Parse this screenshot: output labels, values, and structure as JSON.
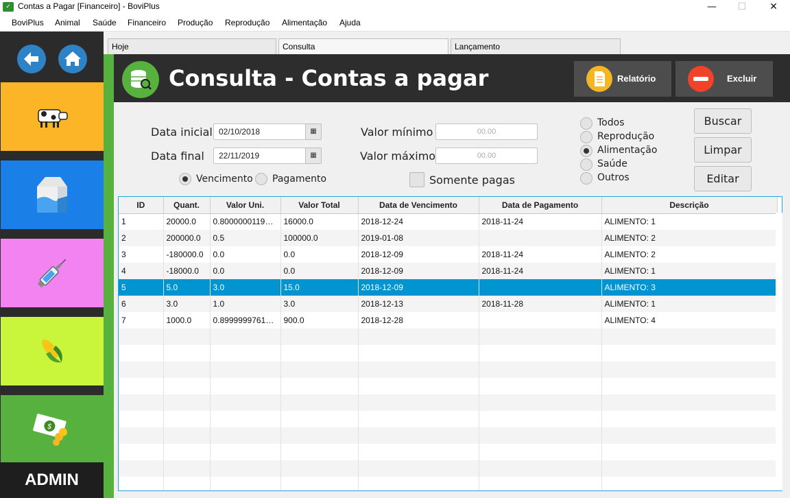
{
  "window": {
    "title": "Contas a Pagar [Financeiro] - BoviPlus",
    "minimize": "—",
    "maximize": "☐",
    "close": "✕"
  },
  "menu": [
    "BoviPlus",
    "Animal",
    "Saúde",
    "Financeiro",
    "Produção",
    "Reprodução",
    "Alimentação",
    "Ajuda"
  ],
  "sidebar": {
    "back_icon": "arrow-left-icon",
    "home_icon": "home-icon",
    "tiles": [
      {
        "name": "cow",
        "color": "#fbb526"
      },
      {
        "name": "milk",
        "color": "#1a80e8"
      },
      {
        "name": "syringe",
        "color": "#f283f0"
      },
      {
        "name": "corn",
        "color": "#c9f53a"
      },
      {
        "name": "money",
        "color": "#57b13e"
      }
    ],
    "admin_label": "ADMIN"
  },
  "tabs": [
    "Hoje",
    "Consulta",
    "Lançamento"
  ],
  "header": {
    "title": "Consulta - Contas a pagar",
    "report_button": "Relatório",
    "delete_button": "Excluir"
  },
  "filters": {
    "start_date_label": "Data inicial",
    "start_date": "02/10/2018",
    "end_date_label": "Data final",
    "end_date": "22/11/2019",
    "min_value_label": "Valor mínimo",
    "min_value_placeholder": "00.00",
    "max_value_label": "Valor máximo",
    "max_value_placeholder": "00.00",
    "date_type": [
      {
        "label": "Vencimento",
        "selected": true
      },
      {
        "label": "Pagamento",
        "selected": false
      }
    ],
    "only_paid_label": "Somente pagas",
    "only_paid_checked": false,
    "categories": [
      {
        "label": "Todos",
        "selected": false
      },
      {
        "label": "Reprodução",
        "selected": false
      },
      {
        "label": "Alimentação",
        "selected": true
      },
      {
        "label": "Saúde",
        "selected": false
      },
      {
        "label": "Outros",
        "selected": false
      }
    ]
  },
  "actions": {
    "search": "Buscar",
    "clear": "Limpar",
    "edit": "Editar"
  },
  "table": {
    "columns": [
      "ID",
      "Quant.",
      "Valor Uni.",
      "Valor Total",
      "Data de Vencimento",
      "Data de Pagamento",
      "Descrição"
    ],
    "rows": [
      [
        "1",
        "20000.0",
        "0.800000011920...",
        "16000.0",
        "2018-12-24",
        "2018-11-24",
        "ALIMENTO: 1"
      ],
      [
        "2",
        "200000.0",
        "0.5",
        "100000.0",
        "2019-01-08",
        "",
        "ALIMENTO: 2"
      ],
      [
        "3",
        "-180000.0",
        "0.0",
        "0.0",
        "2018-12-09",
        "2018-11-24",
        "ALIMENTO: 2"
      ],
      [
        "4",
        "-18000.0",
        "0.0",
        "0.0",
        "2018-12-09",
        "2018-11-24",
        "ALIMENTO: 1"
      ],
      [
        "5",
        "5.0",
        "3.0",
        "15.0",
        "2018-12-09",
        "",
        "ALIMENTO: 3"
      ],
      [
        "6",
        "3.0",
        "1.0",
        "3.0",
        "2018-12-13",
        "2018-11-28",
        "ALIMENTO: 1"
      ],
      [
        "7",
        "1000.0",
        "0.899999976158...",
        "900.0",
        "2018-12-28",
        "",
        "ALIMENTO: 4"
      ]
    ],
    "selected_row": 4,
    "empty_rows": 10
  }
}
